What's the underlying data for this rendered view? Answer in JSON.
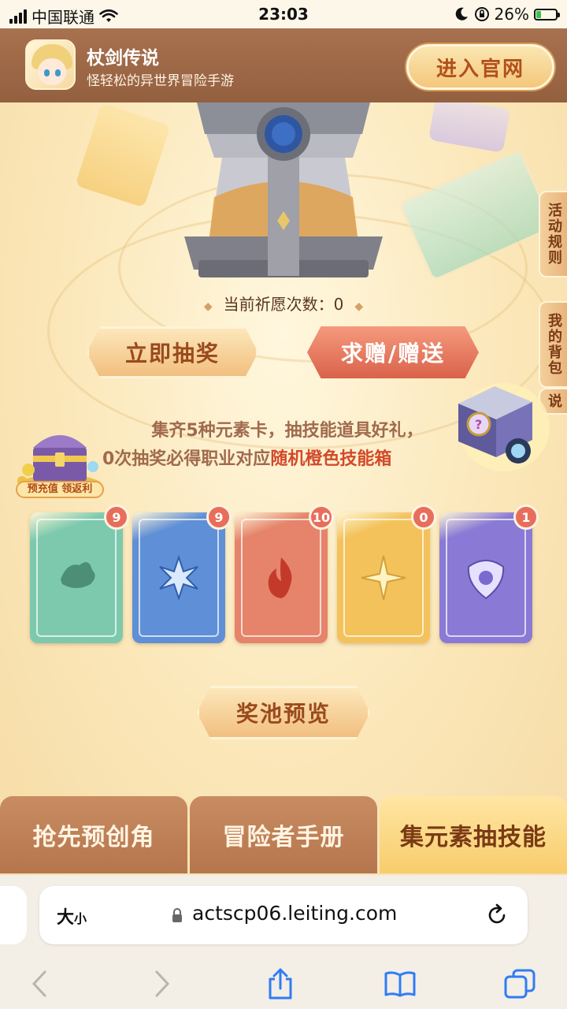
{
  "status_bar": {
    "carrier": "中国联通",
    "time": "23:03",
    "battery_percent": "26%",
    "battery_level": 0.26
  },
  "header": {
    "app_name": "杖剑传说",
    "app_tagline": "怪轻松的异世界冒险手游",
    "official_site_button": "进入官网"
  },
  "side_tabs": {
    "rules": "活动规则",
    "backpack": "我的背包",
    "partial": "说"
  },
  "wish": {
    "label": "当前祈愿次数：",
    "count": "0"
  },
  "buttons": {
    "draw": "立即抽奖",
    "gift": "求赠/赠送",
    "pool_preview": "奖池预览"
  },
  "promo": {
    "label": "预充值 领返利"
  },
  "info": {
    "line1": "集齐5种元素卡，抽技能道具好礼，",
    "line2_prefix": "0次抽奖必得职业对应",
    "line2_highlight": "随机橙色技能箱"
  },
  "cards": [
    {
      "element": "wind",
      "count": "9",
      "color": "#7cc9ae"
    },
    {
      "element": "ice",
      "count": "9",
      "color": "#5f8fd6"
    },
    {
      "element": "fire",
      "count": "10",
      "color": "#e5846a"
    },
    {
      "element": "light",
      "count": "0",
      "color": "#f3c25a"
    },
    {
      "element": "dark",
      "count": "1",
      "color": "#8a7ad6"
    }
  ],
  "tabs": [
    {
      "label": "抢先预创角",
      "active": false
    },
    {
      "label": "冒险者手册",
      "active": false
    },
    {
      "label": "集元素抽技能",
      "active": true
    }
  ],
  "browser": {
    "text_size_label": "大",
    "text_size_small": "小",
    "url": "actscp06.leiting.com"
  },
  "colors": {
    "header_brown": "#a8714f",
    "highlight_red": "#d24a2a",
    "badge_red": "#e86e5c",
    "active_tab_gold": "#f8cc6c"
  }
}
